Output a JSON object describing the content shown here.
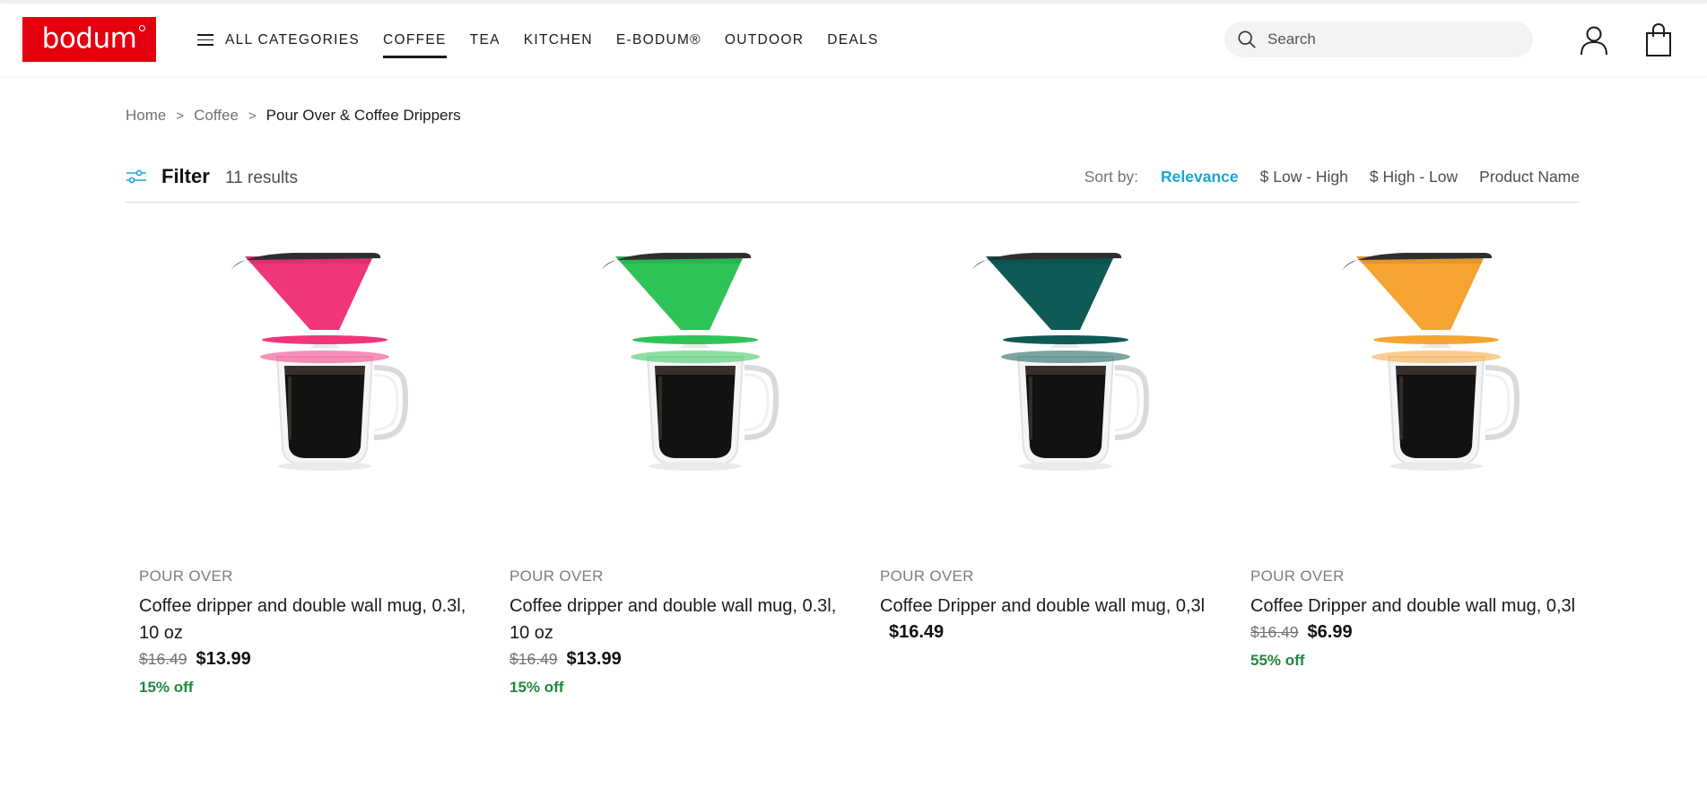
{
  "header": {
    "logo_text": "bodum",
    "nav": [
      {
        "label": "ALL CATEGORIES",
        "icon": "menu-icon"
      },
      {
        "label": "COFFEE",
        "active": true
      },
      {
        "label": "TEA"
      },
      {
        "label": "KITCHEN"
      },
      {
        "label": "E-BODUM®"
      },
      {
        "label": "OUTDOOR"
      },
      {
        "label": "DEALS"
      }
    ],
    "search_placeholder": "Search",
    "icons": {
      "search": "search-icon",
      "account": "user-icon",
      "cart": "shopping-bag-icon"
    }
  },
  "breadcrumb": {
    "home": "Home",
    "category": "Coffee",
    "current": "Pour Over & Coffee Drippers",
    "separator": ">"
  },
  "filterbar": {
    "filter_label": "Filter",
    "results": "11 results",
    "sort_label": "Sort by:",
    "sort_options": [
      "Relevance",
      "$ Low - High",
      "$ High - Low",
      "Product Name"
    ],
    "active_sort": "Relevance"
  },
  "colors": {
    "brand_red": "#e3000f",
    "accent_blue": "#1aa6d0",
    "discount_green": "#1e8a3c"
  },
  "products": [
    {
      "category": "POUR OVER",
      "name": "Coffee dripper and double wall mug, 0.3l, 10 oz",
      "old_price": "$16.49",
      "price": "$13.99",
      "discount": "15% off",
      "dripper_color": "#f0357a"
    },
    {
      "category": "POUR OVER",
      "name": "Coffee dripper and double wall mug, 0.3l, 10 oz",
      "old_price": "$16.49",
      "price": "$13.99",
      "discount": "15% off",
      "dripper_color": "#2fc458"
    },
    {
      "category": "POUR OVER",
      "name": "Coffee Dripper and double wall mug, 0,3l",
      "old_price": "",
      "price": "$16.49",
      "discount": "",
      "dripper_color": "#0e5a55"
    },
    {
      "category": "POUR OVER",
      "name": "Coffee Dripper and double wall mug, 0,3l",
      "old_price": "$16.49",
      "price": "$6.99",
      "discount": "55% off",
      "dripper_color": "#f5a431"
    }
  ]
}
